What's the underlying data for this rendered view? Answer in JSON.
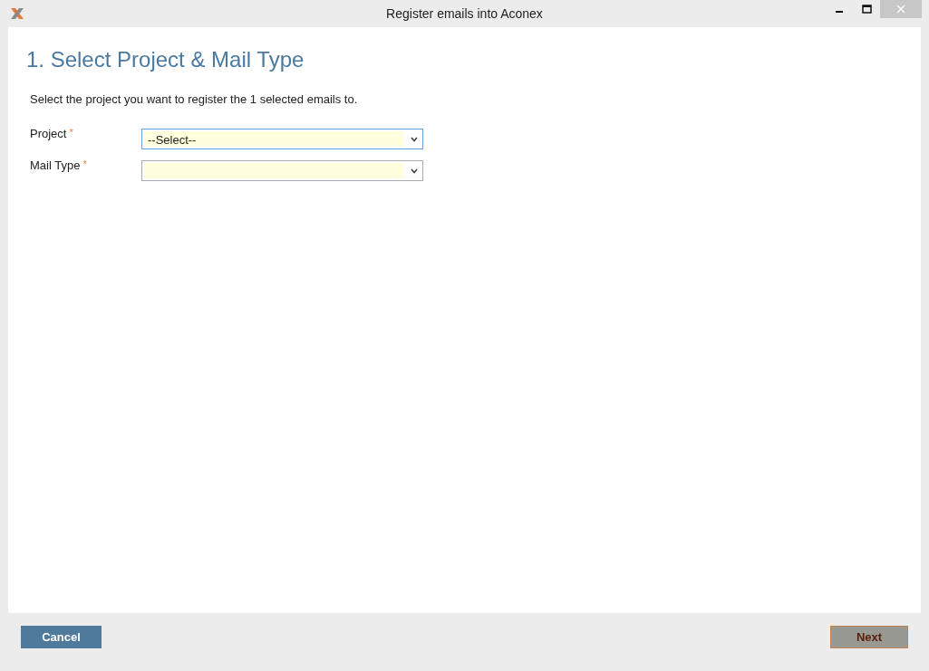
{
  "window": {
    "title": "Register emails into Aconex"
  },
  "heading": "1. Select Project & Mail Type",
  "instructions": "Select the project you want to register the 1 selected emails to.",
  "fields": [
    {
      "label": "Project",
      "required_mark": "*",
      "value": "--Select--",
      "focused": true
    },
    {
      "label": "Mail Type",
      "required_mark": "*",
      "focused": false
    }
  ],
  "buttons": [
    {
      "label": "Cancel",
      "kind": "secondary",
      "disabled": false
    },
    {
      "label": "Next",
      "kind": "primary",
      "disabled": true
    }
  ]
}
